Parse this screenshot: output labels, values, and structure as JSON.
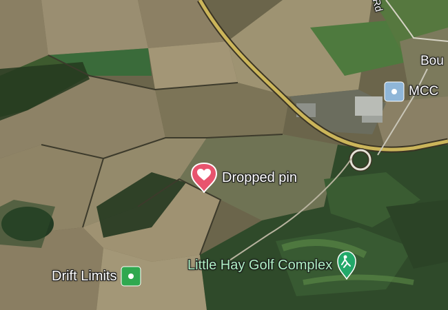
{
  "map": {
    "pin": {
      "label": "Dropped pin",
      "icon": "dropped-pin-heart-icon",
      "color": "#e8546e"
    },
    "places": [
      {
        "key": "drift",
        "label": "Drift Limits",
        "icon": "green-square-icon",
        "color": "#2fa84f"
      },
      {
        "key": "golf",
        "label": "Little Hay Golf Complex",
        "icon": "golf-icon",
        "color": "#23a96a"
      },
      {
        "key": "mcc",
        "label": "MCC",
        "icon": "building-icon",
        "color": "#8fb6d8"
      }
    ],
    "partial_labels": {
      "town": "Bou",
      "road": "Rd"
    },
    "road_color": "#c9b45a"
  }
}
